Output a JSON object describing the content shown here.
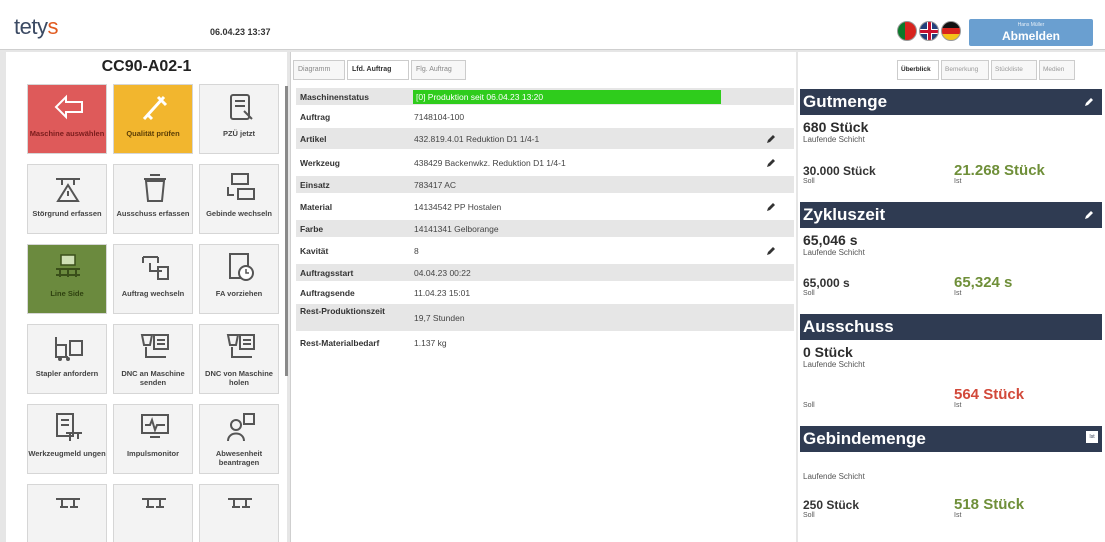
{
  "header": {
    "logo_main": "tety",
    "logo_accent": "s",
    "datetime": "06.04.23 13:37",
    "user_name": "Hans Müller",
    "logout_label": "Abmelden",
    "flags": [
      "Portugal",
      "United Kingdom",
      "Germany"
    ]
  },
  "machine": {
    "title": "CC90-A02-1"
  },
  "sidebar": {
    "tiles": [
      {
        "label": "Maschine auswählen",
        "color": "#de5a5a",
        "icon": "arrow-left-icon"
      },
      {
        "label": "Qualität prüfen",
        "color": "#f2b62e",
        "icon": "caliper-icon"
      },
      {
        "label": "PZÜ jetzt",
        "color": "#f3f3f3",
        "icon": "document-wrench-icon"
      },
      {
        "label": "Störgrund erfassen",
        "color": "#f3f3f3",
        "icon": "machine-warning-icon"
      },
      {
        "label": "Ausschuss erfassen",
        "color": "#f3f3f3",
        "icon": "trash-icon"
      },
      {
        "label": "Gebinde wechseln",
        "color": "#f3f3f3",
        "icon": "container-swap-icon"
      },
      {
        "label": "Line Side",
        "color": "#6b8a3e",
        "icon": "pallet-icon"
      },
      {
        "label": "Auftrag wechseln",
        "color": "#f3f3f3",
        "icon": "order-swap-icon"
      },
      {
        "label": "FA vorziehen",
        "color": "#f3f3f3",
        "icon": "document-clock-icon"
      },
      {
        "label": "Stapler anfordern",
        "color": "#f3f3f3",
        "icon": "forklift-icon"
      },
      {
        "label": "DNC an Maschine senden",
        "color": "#f3f3f3",
        "icon": "dnc-send-icon"
      },
      {
        "label": "DNC von Maschine holen",
        "color": "#f3f3f3",
        "icon": "dnc-fetch-icon"
      },
      {
        "label": "Werkzeugmeld ungen",
        "color": "#f3f3f3",
        "icon": "tool-report-icon"
      },
      {
        "label": "Impulsmonitor",
        "color": "#f3f3f3",
        "icon": "pulse-monitor-icon"
      },
      {
        "label": "Abwesenheit beantragen",
        "color": "#f3f3f3",
        "icon": "absence-icon"
      },
      {
        "label": "",
        "color": "#f3f3f3",
        "icon": "machine-icon"
      },
      {
        "label": "",
        "color": "#f3f3f3",
        "icon": "machine-icon"
      },
      {
        "label": "",
        "color": "#f3f3f3",
        "icon": "machine-icon"
      }
    ]
  },
  "middle": {
    "tabs": [
      "Diagramm",
      "Lfd. Auftrag",
      "Flg. Auftrag"
    ],
    "active_tab": "Lfd. Auftrag",
    "rows": [
      {
        "key": "Maschinenstatus",
        "value": "[0] Produktion seit 06.04.23 13:20",
        "editable": false
      },
      {
        "key": "Auftrag",
        "value": "7148104-100",
        "editable": false
      },
      {
        "key": "Artikel",
        "value": "432.819.4.01 Reduktion D1 1/4-1",
        "editable": true
      },
      {
        "key": "Werkzeug",
        "value": "438429 Backenwkz. Reduktion D1 1/4-1",
        "editable": true
      },
      {
        "key": "Einsatz",
        "value": "783417 AC",
        "editable": false
      },
      {
        "key": "Material",
        "value": "14134542 PP Hostalen",
        "editable": true
      },
      {
        "key": "Farbe",
        "value": "14141341 Gelborange",
        "editable": false
      },
      {
        "key": "Kavität",
        "value": "8",
        "editable": true
      },
      {
        "key": "Auftragsstart",
        "value": "04.04.23 00:22",
        "editable": false
      },
      {
        "key": "Auftragsende",
        "value": "11.04.23 15:01",
        "editable": false
      },
      {
        "key": "Rest-Produktionszeit",
        "value": "19,7 Stunden",
        "editable": false
      },
      {
        "key": "Rest-Materialbedarf",
        "value": "1.137 kg",
        "editable": false
      }
    ],
    "status_color": "#2fcc1c"
  },
  "right": {
    "tabs": [
      "Überblick",
      "Bemerkung",
      "Stückliste",
      "Medien"
    ],
    "active_tab": "Überblick",
    "cards": {
      "gutmenge": {
        "title": "Gutmenge",
        "shift_value": "680 Stück",
        "shift_label": "Laufende Schicht",
        "soll_value": "30.000 Stück",
        "soll_label": "Soll",
        "ist_value": "21.268 Stück",
        "ist_label": "Ist"
      },
      "zykluszeit": {
        "title": "Zykluszeit",
        "shift_value": "65,046 s",
        "shift_label": "Laufende Schicht",
        "soll_value": "65,000 s",
        "soll_label": "Soll",
        "ist_value": "65,324 s",
        "ist_label": "Ist"
      },
      "ausschuss": {
        "title": "Ausschuss",
        "shift_value": "0 Stück",
        "shift_label": "Laufende Schicht",
        "soll_value": "",
        "soll_label": "Soll",
        "ist_value": "564 Stück",
        "ist_label": "Ist"
      },
      "gebindemenge": {
        "title": "Gebindemenge",
        "shift_label": "Laufende Schicht",
        "soll_value": "250 Stück",
        "soll_label": "Soll",
        "ist_value": "518 Stück",
        "ist_label": "Ist",
        "badge": "Ist"
      }
    },
    "colors": {
      "header_bg": "#2f3b52",
      "ist_good": "#6f8f39",
      "ist_bad": "#d2493a"
    }
  }
}
